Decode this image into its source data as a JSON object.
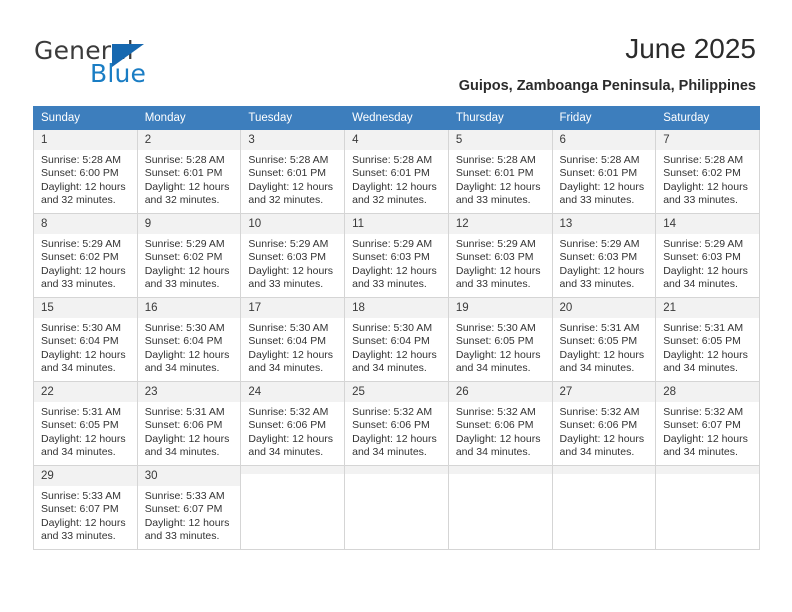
{
  "brand": {
    "name_top": "General",
    "name_bottom": "Blue",
    "triangle_color": "#1668b0",
    "blue_color": "#1a7dc4"
  },
  "header": {
    "title": "June 2025",
    "subtitle": "Guipos, Zamboanga Peninsula, Philippines",
    "header_bg": "#3d7ebd"
  },
  "weekdays": [
    "Sunday",
    "Monday",
    "Tuesday",
    "Wednesday",
    "Thursday",
    "Friday",
    "Saturday"
  ],
  "weeks": [
    [
      {
        "day": "1",
        "sunrise": "Sunrise: 5:28 AM",
        "sunset": "Sunset: 6:00 PM",
        "daylight1": "Daylight: 12 hours",
        "daylight2": "and 32 minutes."
      },
      {
        "day": "2",
        "sunrise": "Sunrise: 5:28 AM",
        "sunset": "Sunset: 6:01 PM",
        "daylight1": "Daylight: 12 hours",
        "daylight2": "and 32 minutes."
      },
      {
        "day": "3",
        "sunrise": "Sunrise: 5:28 AM",
        "sunset": "Sunset: 6:01 PM",
        "daylight1": "Daylight: 12 hours",
        "daylight2": "and 32 minutes."
      },
      {
        "day": "4",
        "sunrise": "Sunrise: 5:28 AM",
        "sunset": "Sunset: 6:01 PM",
        "daylight1": "Daylight: 12 hours",
        "daylight2": "and 32 minutes."
      },
      {
        "day": "5",
        "sunrise": "Sunrise: 5:28 AM",
        "sunset": "Sunset: 6:01 PM",
        "daylight1": "Daylight: 12 hours",
        "daylight2": "and 33 minutes."
      },
      {
        "day": "6",
        "sunrise": "Sunrise: 5:28 AM",
        "sunset": "Sunset: 6:01 PM",
        "daylight1": "Daylight: 12 hours",
        "daylight2": "and 33 minutes."
      },
      {
        "day": "7",
        "sunrise": "Sunrise: 5:28 AM",
        "sunset": "Sunset: 6:02 PM",
        "daylight1": "Daylight: 12 hours",
        "daylight2": "and 33 minutes."
      }
    ],
    [
      {
        "day": "8",
        "sunrise": "Sunrise: 5:29 AM",
        "sunset": "Sunset: 6:02 PM",
        "daylight1": "Daylight: 12 hours",
        "daylight2": "and 33 minutes."
      },
      {
        "day": "9",
        "sunrise": "Sunrise: 5:29 AM",
        "sunset": "Sunset: 6:02 PM",
        "daylight1": "Daylight: 12 hours",
        "daylight2": "and 33 minutes."
      },
      {
        "day": "10",
        "sunrise": "Sunrise: 5:29 AM",
        "sunset": "Sunset: 6:03 PM",
        "daylight1": "Daylight: 12 hours",
        "daylight2": "and 33 minutes."
      },
      {
        "day": "11",
        "sunrise": "Sunrise: 5:29 AM",
        "sunset": "Sunset: 6:03 PM",
        "daylight1": "Daylight: 12 hours",
        "daylight2": "and 33 minutes."
      },
      {
        "day": "12",
        "sunrise": "Sunrise: 5:29 AM",
        "sunset": "Sunset: 6:03 PM",
        "daylight1": "Daylight: 12 hours",
        "daylight2": "and 33 minutes."
      },
      {
        "day": "13",
        "sunrise": "Sunrise: 5:29 AM",
        "sunset": "Sunset: 6:03 PM",
        "daylight1": "Daylight: 12 hours",
        "daylight2": "and 33 minutes."
      },
      {
        "day": "14",
        "sunrise": "Sunrise: 5:29 AM",
        "sunset": "Sunset: 6:03 PM",
        "daylight1": "Daylight: 12 hours",
        "daylight2": "and 34 minutes."
      }
    ],
    [
      {
        "day": "15",
        "sunrise": "Sunrise: 5:30 AM",
        "sunset": "Sunset: 6:04 PM",
        "daylight1": "Daylight: 12 hours",
        "daylight2": "and 34 minutes."
      },
      {
        "day": "16",
        "sunrise": "Sunrise: 5:30 AM",
        "sunset": "Sunset: 6:04 PM",
        "daylight1": "Daylight: 12 hours",
        "daylight2": "and 34 minutes."
      },
      {
        "day": "17",
        "sunrise": "Sunrise: 5:30 AM",
        "sunset": "Sunset: 6:04 PM",
        "daylight1": "Daylight: 12 hours",
        "daylight2": "and 34 minutes."
      },
      {
        "day": "18",
        "sunrise": "Sunrise: 5:30 AM",
        "sunset": "Sunset: 6:04 PM",
        "daylight1": "Daylight: 12 hours",
        "daylight2": "and 34 minutes."
      },
      {
        "day": "19",
        "sunrise": "Sunrise: 5:30 AM",
        "sunset": "Sunset: 6:05 PM",
        "daylight1": "Daylight: 12 hours",
        "daylight2": "and 34 minutes."
      },
      {
        "day": "20",
        "sunrise": "Sunrise: 5:31 AM",
        "sunset": "Sunset: 6:05 PM",
        "daylight1": "Daylight: 12 hours",
        "daylight2": "and 34 minutes."
      },
      {
        "day": "21",
        "sunrise": "Sunrise: 5:31 AM",
        "sunset": "Sunset: 6:05 PM",
        "daylight1": "Daylight: 12 hours",
        "daylight2": "and 34 minutes."
      }
    ],
    [
      {
        "day": "22",
        "sunrise": "Sunrise: 5:31 AM",
        "sunset": "Sunset: 6:05 PM",
        "daylight1": "Daylight: 12 hours",
        "daylight2": "and 34 minutes."
      },
      {
        "day": "23",
        "sunrise": "Sunrise: 5:31 AM",
        "sunset": "Sunset: 6:06 PM",
        "daylight1": "Daylight: 12 hours",
        "daylight2": "and 34 minutes."
      },
      {
        "day": "24",
        "sunrise": "Sunrise: 5:32 AM",
        "sunset": "Sunset: 6:06 PM",
        "daylight1": "Daylight: 12 hours",
        "daylight2": "and 34 minutes."
      },
      {
        "day": "25",
        "sunrise": "Sunrise: 5:32 AM",
        "sunset": "Sunset: 6:06 PM",
        "daylight1": "Daylight: 12 hours",
        "daylight2": "and 34 minutes."
      },
      {
        "day": "26",
        "sunrise": "Sunrise: 5:32 AM",
        "sunset": "Sunset: 6:06 PM",
        "daylight1": "Daylight: 12 hours",
        "daylight2": "and 34 minutes."
      },
      {
        "day": "27",
        "sunrise": "Sunrise: 5:32 AM",
        "sunset": "Sunset: 6:06 PM",
        "daylight1": "Daylight: 12 hours",
        "daylight2": "and 34 minutes."
      },
      {
        "day": "28",
        "sunrise": "Sunrise: 5:32 AM",
        "sunset": "Sunset: 6:07 PM",
        "daylight1": "Daylight: 12 hours",
        "daylight2": "and 34 minutes."
      }
    ],
    [
      {
        "day": "29",
        "sunrise": "Sunrise: 5:33 AM",
        "sunset": "Sunset: 6:07 PM",
        "daylight1": "Daylight: 12 hours",
        "daylight2": "and 33 minutes."
      },
      {
        "day": "30",
        "sunrise": "Sunrise: 5:33 AM",
        "sunset": "Sunset: 6:07 PM",
        "daylight1": "Daylight: 12 hours",
        "daylight2": "and 33 minutes."
      },
      {
        "day": "",
        "sunrise": "",
        "sunset": "",
        "daylight1": "",
        "daylight2": ""
      },
      {
        "day": "",
        "sunrise": "",
        "sunset": "",
        "daylight1": "",
        "daylight2": ""
      },
      {
        "day": "",
        "sunrise": "",
        "sunset": "",
        "daylight1": "",
        "daylight2": ""
      },
      {
        "day": "",
        "sunrise": "",
        "sunset": "",
        "daylight1": "",
        "daylight2": ""
      },
      {
        "day": "",
        "sunrise": "",
        "sunset": "",
        "daylight1": "",
        "daylight2": ""
      }
    ]
  ]
}
